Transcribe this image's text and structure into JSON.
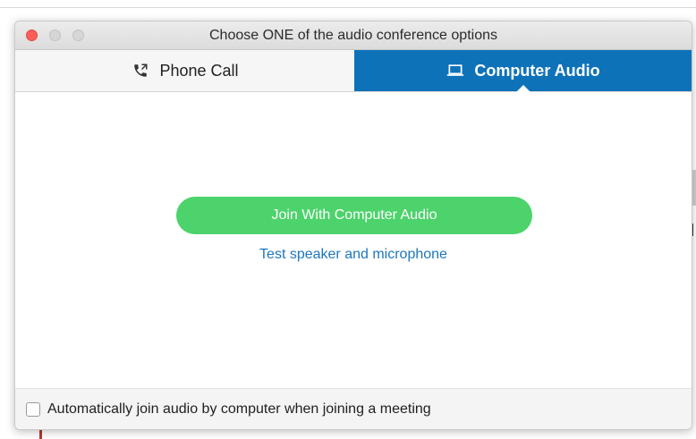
{
  "window": {
    "title": "Choose ONE of the audio conference options"
  },
  "tabs": [
    {
      "label": "Phone Call",
      "icon": "phone-icon",
      "selected": false
    },
    {
      "label": "Computer Audio",
      "icon": "laptop-icon",
      "selected": true
    }
  ],
  "main": {
    "join_button_label": "Join With Computer Audio",
    "test_link_label": "Test speaker and microphone"
  },
  "footer": {
    "auto_join_label": "Automatically join audio by computer when joining a meeting",
    "auto_join_checked": false
  },
  "colors": {
    "accent_blue": "#0e72b9",
    "join_green": "#4cd36b",
    "link_blue": "#1d76bc",
    "close_red": "#fc5f57"
  }
}
